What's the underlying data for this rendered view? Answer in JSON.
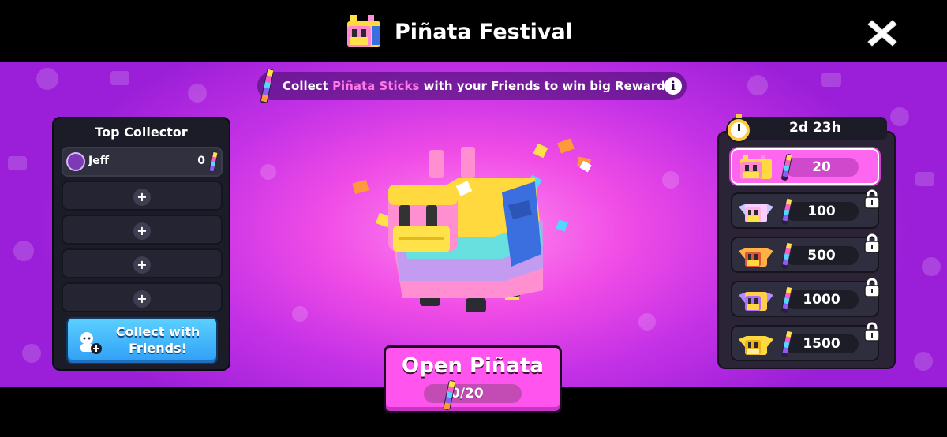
{
  "header": {
    "title": "Piñata Festival",
    "close_icon": "close-x-icon"
  },
  "banner": {
    "prefix": "Collect ",
    "highlight": "Piñata Sticks",
    "suffix": " with your Friends to win big Rewards!",
    "info_icon": "info-icon"
  },
  "top_collector": {
    "title": "Top Collector",
    "player": {
      "name": "Jeff",
      "count": "0"
    },
    "empty_slots": [
      "+",
      "+",
      "+",
      "+"
    ],
    "collect_button": "Collect with Friends!"
  },
  "open_button": {
    "label": "Open Piñata",
    "progress": "0/20"
  },
  "timer": {
    "remaining": "2d 23h"
  },
  "reward_tiers": [
    {
      "value": "20",
      "locked": false,
      "color": "#ff66ef"
    },
    {
      "value": "100",
      "locked": true
    },
    {
      "value": "500",
      "locked": true
    },
    {
      "value": "1000",
      "locked": true
    },
    {
      "value": "1500",
      "locked": true
    }
  ],
  "colors": {
    "accent": "#ff55ee",
    "highlight_text": "#ff7ae6",
    "button_blue": "#2f9ef7"
  }
}
